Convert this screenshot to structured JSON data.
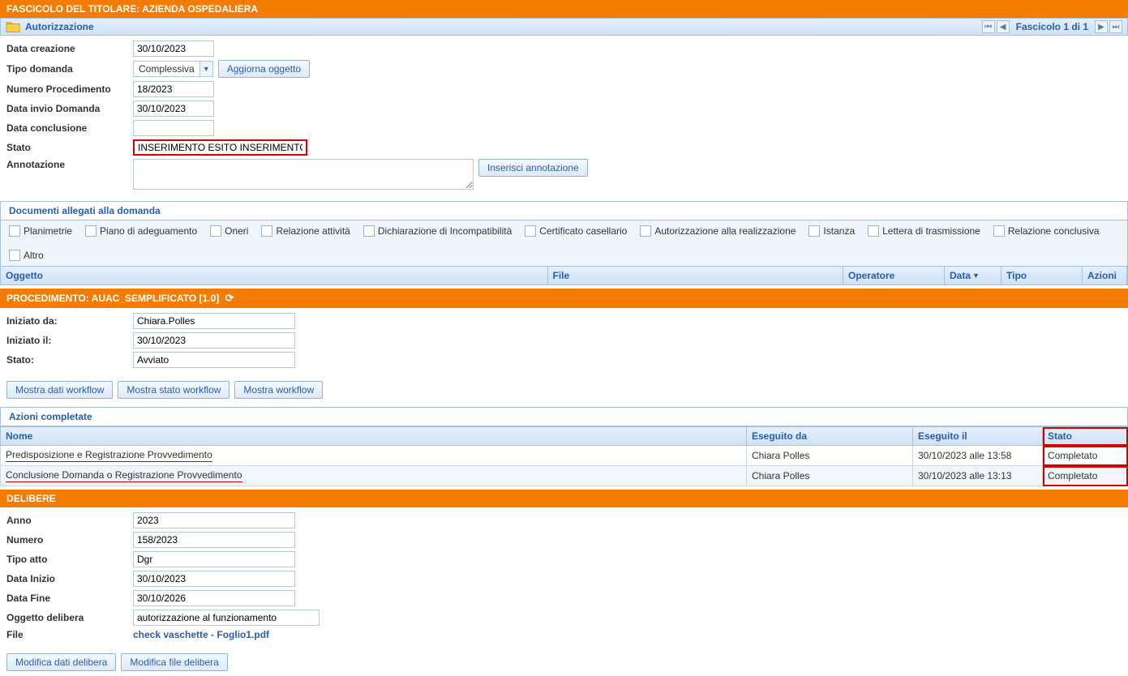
{
  "fascicolo": {
    "header": "FASCICOLO DEL TITOLARE: AZIENDA OSPEDALIERA",
    "autorizzazione_title": "Autorizzazione",
    "counter": "Fascicolo 1 di 1",
    "fields": {
      "data_creazione_label": "Data creazione",
      "data_creazione": "30/10/2023",
      "tipo_domanda_label": "Tipo domanda",
      "tipo_domanda": "Complessiva",
      "aggiorna_oggetto": "Aggiorna oggetto",
      "numero_procedimento_label": "Numero Procedimento",
      "numero_procedimento": "18/2023",
      "data_invio_label": "Data invio Domanda",
      "data_invio": "30/10/2023",
      "data_conclusione_label": "Data conclusione",
      "data_conclusione": "",
      "stato_label": "Stato",
      "stato_value": "INSERIMENTO ESITO INSERIMENTO ESITI",
      "annotazione_label": "Annotazione",
      "inserisci_annotazione": "Inserisci annotazione"
    }
  },
  "documenti": {
    "title": "Documenti allegati alla domanda",
    "types": [
      "Planimetrie",
      "Piano di adeguamento",
      "Oneri",
      "Relazione attività",
      "Dichiarazione di Incompatibilità",
      "Certificato casellario",
      "Autorizzazione alla realizzazione",
      "Istanza",
      "Lettera di trasmissione",
      "Relazione conclusiva",
      "Altro"
    ],
    "columns": {
      "oggetto": "Oggetto",
      "file": "File",
      "operatore": "Operatore",
      "data": "Data",
      "tipo": "Tipo",
      "azioni": "Azioni"
    }
  },
  "procedimento": {
    "header": "PROCEDIMENTO: AUAC_SEMPLIFICATO [1.0]",
    "iniziato_da_label": "Iniziato da:",
    "iniziato_da": "Chiara.Polles",
    "iniziato_il_label": "Iniziato il:",
    "iniziato_il": "30/10/2023",
    "stato_label": "Stato:",
    "stato": "Avviato",
    "buttons": {
      "mostra_dati": "Mostra dati workflow",
      "mostra_stato": "Mostra stato workflow",
      "mostra_wf": "Mostra workflow"
    }
  },
  "azioni_completate": {
    "title": "Azioni completate",
    "columns": {
      "nome": "Nome",
      "eseguito_da": "Eseguito da",
      "eseguito_il": "Eseguito il",
      "stato": "Stato"
    },
    "rows": [
      {
        "nome": "Predisposizione e Registrazione Provvedimento",
        "eseguito_da": "Chiara Polles",
        "eseguito_il": "30/10/2023 alle 13:58",
        "stato": "Completato"
      },
      {
        "nome": "Conclusione Domanda o Registrazione Provvedimento",
        "eseguito_da": "Chiara Polles",
        "eseguito_il": "30/10/2023 alle 13:13",
        "stato": "Completato"
      }
    ]
  },
  "delibere": {
    "header": "DELIBERE",
    "anno_label": "Anno",
    "anno": "2023",
    "numero_label": "Numero",
    "numero": "158/2023",
    "tipo_atto_label": "Tipo atto",
    "tipo_atto": "Dgr",
    "data_inizio_label": "Data Inizio",
    "data_inizio": "30/10/2023",
    "data_fine_label": "Data Fine",
    "data_fine": "30/10/2026",
    "oggetto_label": "Oggetto delibera",
    "oggetto": "autorizzazione al funzionamento",
    "file_label": "File",
    "file": "check vaschette - Foglio1.pdf",
    "modifica_dati": "Modifica dati delibera",
    "modifica_file": "Modifica file delibera"
  }
}
